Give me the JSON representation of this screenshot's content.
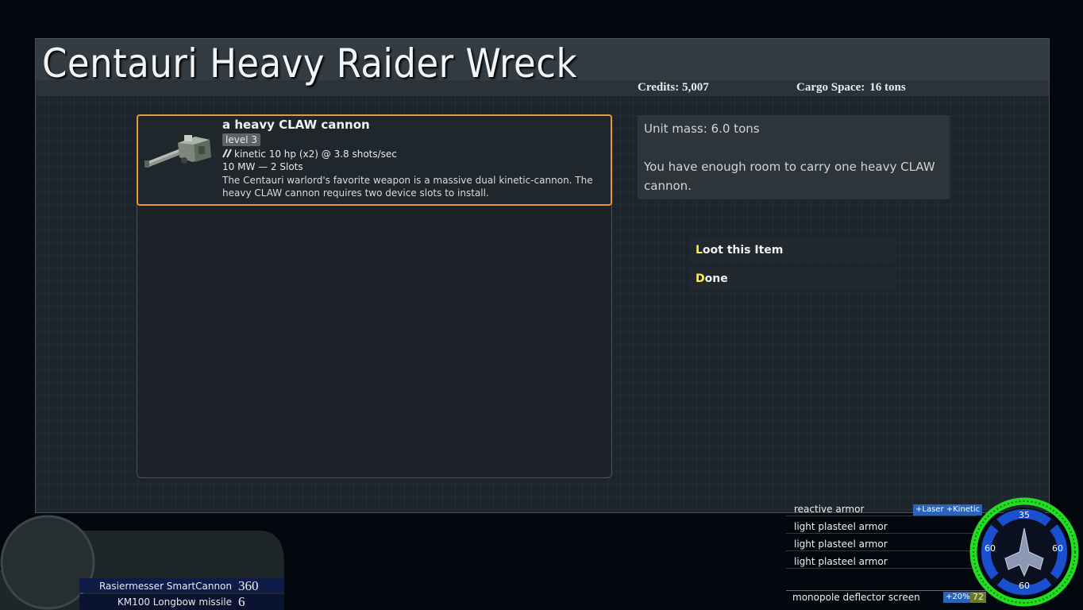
{
  "screen": {
    "title": "Centauri Heavy Raider Wreck",
    "credits": "Credits: 5,007",
    "cargo_label": "Cargo Space:",
    "cargo_value": "16 tons"
  },
  "item": {
    "name": "a heavy CLAW cannon",
    "level": "level 3",
    "stats": "kinetic 10 hp (x2) @ 3.8 shots/sec",
    "power": "10 MW — 2 Slots",
    "description": "The Centauri warlord's favorite weapon is a massive dual kinetic-cannon. The heavy CLAW cannon requires two device slots to install."
  },
  "info": {
    "mass": "Unit mass: 6.0 tons",
    "room": "You have enough room to carry one heavy CLAW cannon."
  },
  "actions": [
    {
      "key": "L",
      "rest": "oot this Item"
    },
    {
      "key": "D",
      "rest": "one"
    }
  ],
  "weapons": [
    {
      "name": "Rasiermesser SmartCannon",
      "ammo": "360"
    },
    {
      "name": "KM100 Longbow missile",
      "ammo": "6"
    }
  ],
  "armor": {
    "segments": [
      {
        "name": "reactive armor",
        "badge": "+Laser +Kinetic"
      },
      {
        "name": "light plasteel armor"
      },
      {
        "name": "light plasteel armor"
      },
      {
        "name": "light plasteel armor"
      }
    ],
    "shield": {
      "name": "monopole deflector screen",
      "bonus": "+20%",
      "level": "72"
    },
    "ring_values": {
      "top": "35",
      "left": "60",
      "right": "60",
      "bottom": "60"
    }
  },
  "colors": {
    "accent": "#e8963a",
    "hotkey": "#ffee44",
    "shield_green": "#22dd22",
    "armor_blue": "#1a4fd0"
  }
}
